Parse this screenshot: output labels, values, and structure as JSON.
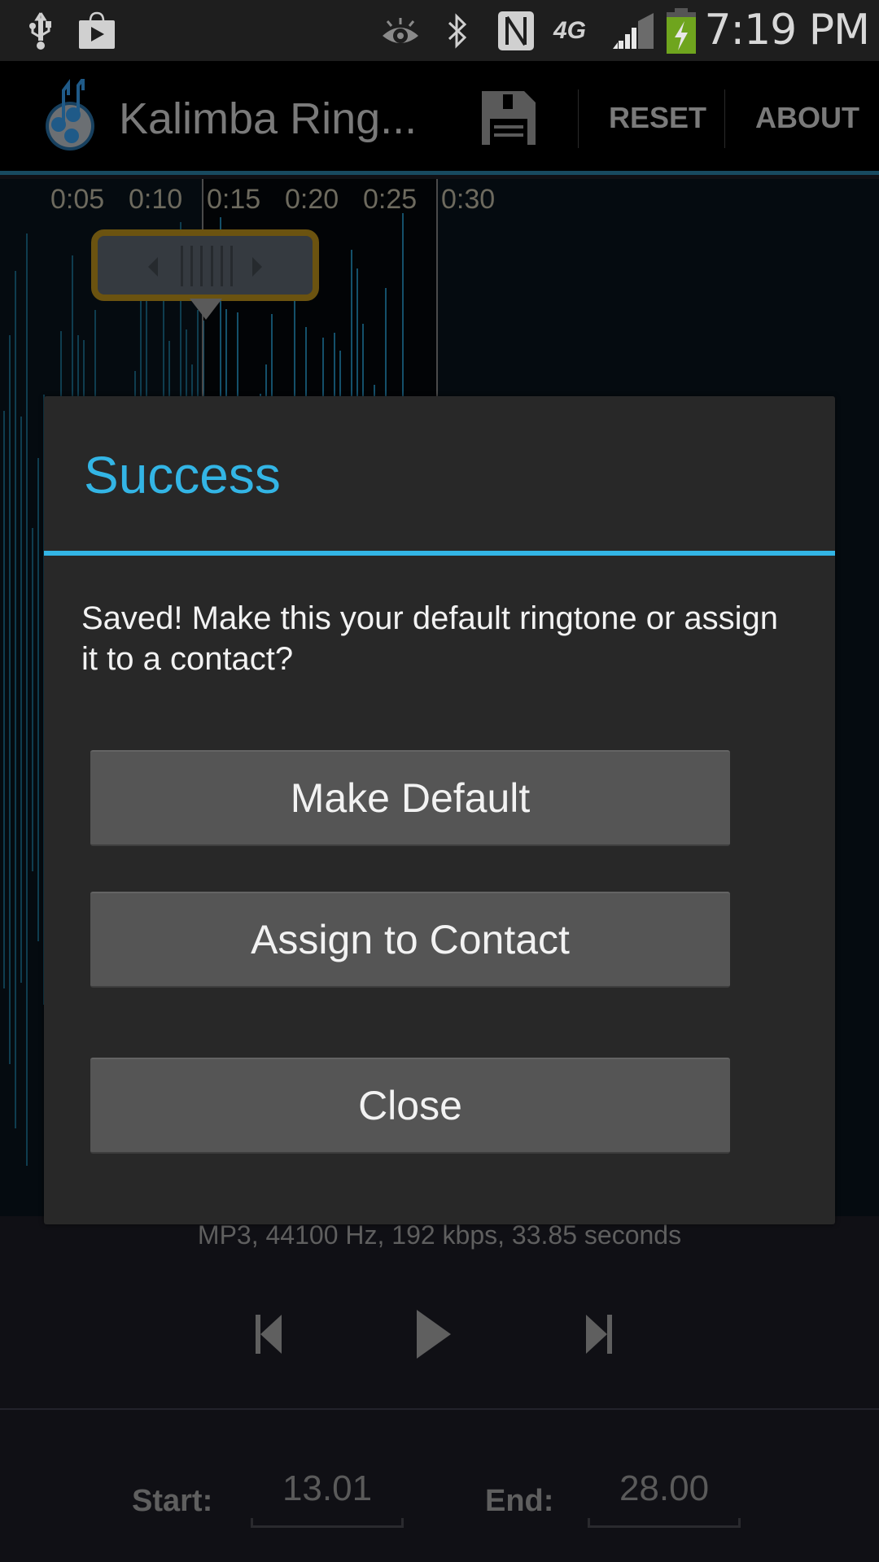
{
  "status_bar": {
    "left_icons": [
      "usb-icon",
      "play-store-icon"
    ],
    "right_icons": [
      "smart-stay-eye-icon",
      "bluetooth-icon",
      "nfc-icon",
      "4g-icon",
      "signal-icon",
      "battery-charging-icon"
    ],
    "network_label": "4G",
    "time": "7:19 PM",
    "battery_color": "#6fa51e"
  },
  "action_bar": {
    "app_icon": "kalimba-music-icon",
    "title": "Kalimba Ring...",
    "save_icon": "floppy-disk-icon",
    "reset_label": "RESET",
    "about_label": "ABOUT",
    "accent_color": "#184a60"
  },
  "waveform": {
    "time_labels": [
      "0:05",
      "0:10",
      "0:15",
      "0:20",
      "0:25",
      "0:30"
    ],
    "handle_icon": "drag-handle-icon"
  },
  "dialog": {
    "title": "Success",
    "message": "Saved! Make this your default ringtone or assign it to a contact?",
    "accent_color": "#33b5e5",
    "buttons": [
      {
        "label": "Make Default"
      },
      {
        "label": "Assign to Contact"
      },
      {
        "label": "Close"
      }
    ]
  },
  "bottom_panel": {
    "file_info": "MP3, 44100 Hz, 192 kbps, 33.85 seconds",
    "transport": [
      "skip-previous-icon",
      "play-icon",
      "skip-next-icon"
    ],
    "start_label": "Start:",
    "start_value": "13.01",
    "end_label": "End:",
    "end_value": "28.00"
  }
}
